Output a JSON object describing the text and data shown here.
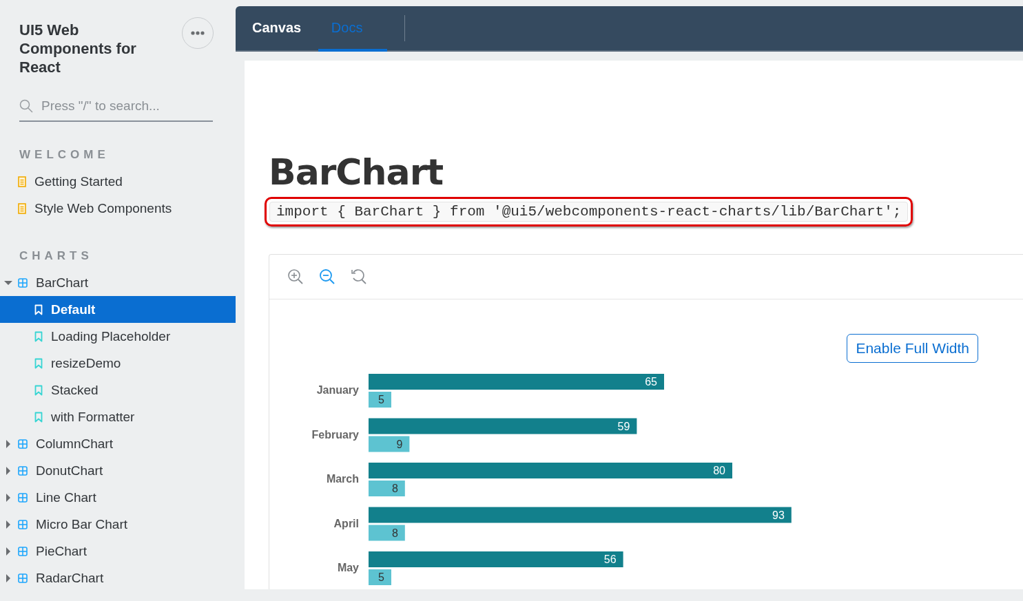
{
  "sidebar": {
    "title": "UI5 Web Components for React",
    "search": {
      "placeholder": "Press \"/\" to search..."
    },
    "sections": [
      {
        "heading": "WELCOME",
        "items": [
          {
            "kind": "doc",
            "label": "Getting Started",
            "selected": false
          },
          {
            "kind": "doc",
            "label": "Style Web Components",
            "selected": false
          }
        ]
      },
      {
        "heading": "CHARTS",
        "items": [
          {
            "kind": "component",
            "label": "BarChart",
            "selected": false,
            "expanded": true,
            "children": [
              {
                "kind": "story",
                "label": "Default",
                "selected": true
              },
              {
                "kind": "story",
                "label": "Loading Placeholder",
                "selected": false
              },
              {
                "kind": "story",
                "label": "resizeDemo",
                "selected": false
              },
              {
                "kind": "story",
                "label": "Stacked",
                "selected": false
              },
              {
                "kind": "story",
                "label": "with Formatter",
                "selected": false
              }
            ]
          },
          {
            "kind": "component",
            "label": "ColumnChart",
            "selected": false,
            "expanded": false
          },
          {
            "kind": "component",
            "label": "DonutChart",
            "selected": false,
            "expanded": false
          },
          {
            "kind": "component",
            "label": "Line Chart",
            "selected": false,
            "expanded": false
          },
          {
            "kind": "component",
            "label": "Micro Bar Chart",
            "selected": false,
            "expanded": false
          },
          {
            "kind": "component",
            "label": "PieChart",
            "selected": false,
            "expanded": false
          },
          {
            "kind": "component",
            "label": "RadarChart",
            "selected": false,
            "expanded": false
          }
        ]
      }
    ]
  },
  "tabs": [
    {
      "label": "Canvas",
      "selected": false
    },
    {
      "label": "Docs",
      "selected": true
    }
  ],
  "doc": {
    "title": "BarChart",
    "import_code": "import { BarChart } from '@ui5/webcomponents-react-charts/lib/BarChart';",
    "full_width_button": "Enable Full Width",
    "chart_data": {
      "type": "bar",
      "orientation": "horizontal",
      "data_labels": true,
      "categories": [
        "January",
        "February",
        "March",
        "April",
        "May"
      ],
      "series": [
        {
          "color": "#12808c",
          "values": [
            65,
            59,
            80,
            93,
            56
          ]
        },
        {
          "color": "#5dc3d1",
          "values": [
            5,
            9,
            8,
            8,
            5
          ]
        }
      ]
    }
  }
}
